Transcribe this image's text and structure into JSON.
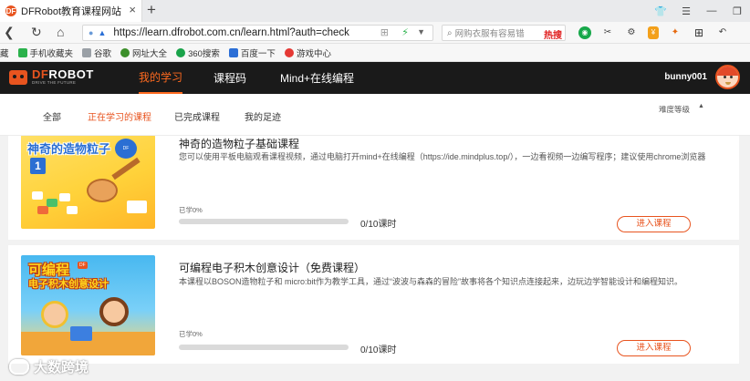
{
  "browser": {
    "tab_title": "DFRobot教育课程网站",
    "tab_favicon": "DF",
    "url": "https://learn.dfrobot.com.cn/learn.html?auth=check",
    "search_placeholder": "网购衣服有容易错",
    "search_hot": "热搜",
    "bookmarks": [
      {
        "label": "藏",
        "icon": "bookmark-icon",
        "color": "#888888"
      },
      {
        "label": "手机收藏夹",
        "icon": "phone-icon",
        "color": "#2bb24c"
      },
      {
        "label": "谷歌",
        "icon": "doc-icon",
        "color": "#9aa0a6"
      },
      {
        "label": "网址大全",
        "icon": "globe-icon",
        "color": "#3c8f2a"
      },
      {
        "label": "360搜索",
        "icon": "360-icon",
        "color": "#1aa34a"
      },
      {
        "label": "百度一下",
        "icon": "paw-icon",
        "color": "#2c6fd6"
      },
      {
        "label": "游戏中心",
        "icon": "game-icon",
        "color": "#e53935"
      }
    ]
  },
  "site": {
    "logo_word_left": "DF",
    "logo_word_right": "ROBOT",
    "logo_tagline": "DRIVE THE FUTURE",
    "nav": [
      {
        "label": "我的学习",
        "active": true
      },
      {
        "label": "课程码",
        "active": false
      },
      {
        "label": "Mind+在线编程",
        "active": false
      }
    ],
    "username": "bunny001",
    "accent_color": "#e8541f"
  },
  "subnav": {
    "tabs": [
      {
        "label": "全部",
        "active": false
      },
      {
        "label": "正在学习的课程",
        "active": true
      },
      {
        "label": "已完成课程",
        "active": false
      },
      {
        "label": "我的足迹",
        "active": false
      }
    ],
    "sort_label": "难度等级"
  },
  "courses": [
    {
      "thumb_title": "神奇的造物粒子",
      "thumb_number": "1",
      "title": "神奇的造物粒子基础课程",
      "description": "您可以使用平板电脑观看课程视频，通过电脑打开mind+在线编程（https://ide.mindplus.top/），一边看视频一边编写程序；建议使用chrome浏览器",
      "learned_label": "已学0%",
      "progress": 0,
      "count": "0/10课时",
      "button": "进入课程"
    },
    {
      "thumb_title": "可编程",
      "thumb_subtitle": "电子积木创意设计",
      "title": "可编程电子积木创意设计（免费课程）",
      "description": "本课程以BOSON造物粒子和 micro:bit作为教学工具，通过“波波与森森的冒险”故事将各个知识点连接起来，边玩边学智能设计和编程知识。",
      "learned_label": "已学0%",
      "progress": 0,
      "count": "0/10课时",
      "button": "进入课程"
    }
  ],
  "watermark": "大数跨境"
}
